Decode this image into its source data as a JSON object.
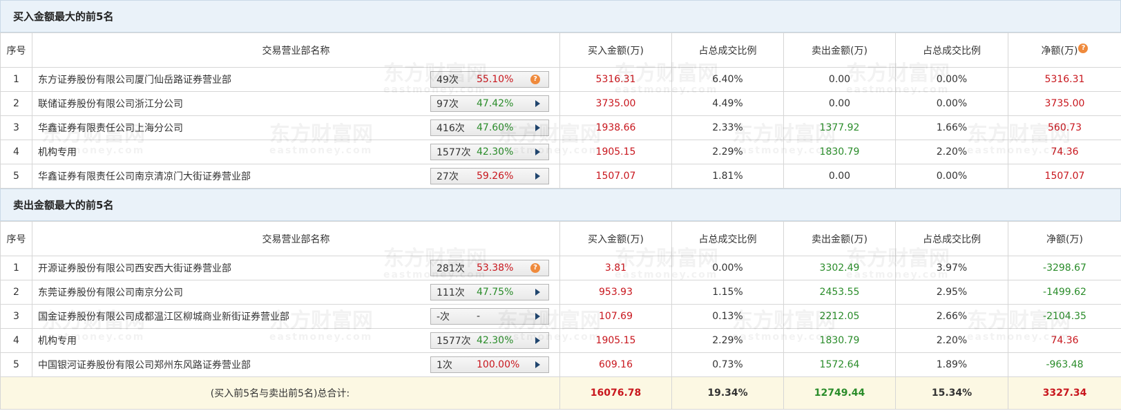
{
  "colors": {
    "red": "#c8161d",
    "green": "#2a8c2a",
    "header_bg": "#eaf2f9",
    "total_bg": "#fcf8e3"
  },
  "watermark": {
    "text": "东方财富网",
    "sub": "eastmoney.com"
  },
  "buy": {
    "title": "买入金额最大的前5名",
    "headers": {
      "idx": "序号",
      "name": "交易营业部名称",
      "buy": "买入金额(万)",
      "buy_ratio": "占总成交比例",
      "sell": "卖出金额(万)",
      "sell_ratio": "占总成交比例",
      "net": "净额(万)"
    },
    "rows": [
      {
        "idx": "1",
        "name": "东方证券股份有限公司厦门仙岳路证券营业部",
        "count": "49次",
        "pct": "55.10%",
        "pct_color": "red",
        "icon": "question-icon",
        "buy": "5316.31",
        "buy_ratio": "6.40%",
        "sell": "0.00",
        "sell_ratio": "0.00%",
        "net": "5316.31",
        "sell_color": "dark",
        "net_color": "red"
      },
      {
        "idx": "2",
        "name": "联储证券股份有限公司浙江分公司",
        "count": "97次",
        "pct": "47.42%",
        "pct_color": "green",
        "icon": "arrow-right-icon",
        "buy": "3735.00",
        "buy_ratio": "4.49%",
        "sell": "0.00",
        "sell_ratio": "0.00%",
        "net": "3735.00",
        "sell_color": "dark",
        "net_color": "red"
      },
      {
        "idx": "3",
        "name": "华鑫证券有限责任公司上海分公司",
        "count": "416次",
        "pct": "47.60%",
        "pct_color": "green",
        "icon": "arrow-right-icon",
        "buy": "1938.66",
        "buy_ratio": "2.33%",
        "sell": "1377.92",
        "sell_ratio": "1.66%",
        "net": "560.73",
        "sell_color": "green",
        "net_color": "red"
      },
      {
        "idx": "4",
        "name": "机构专用",
        "count": "1577次",
        "pct": "42.30%",
        "pct_color": "green",
        "icon": "arrow-right-icon",
        "buy": "1905.15",
        "buy_ratio": "2.29%",
        "sell": "1830.79",
        "sell_ratio": "2.20%",
        "net": "74.36",
        "sell_color": "green",
        "net_color": "red"
      },
      {
        "idx": "5",
        "name": "华鑫证券有限责任公司南京清凉门大街证券营业部",
        "count": "27次",
        "pct": "59.26%",
        "pct_color": "red",
        "icon": "arrow-right-icon",
        "buy": "1507.07",
        "buy_ratio": "1.81%",
        "sell": "0.00",
        "sell_ratio": "0.00%",
        "net": "1507.07",
        "sell_color": "dark",
        "net_color": "red"
      }
    ]
  },
  "sell": {
    "title": "卖出金额最大的前5名",
    "headers": {
      "idx": "序号",
      "name": "交易营业部名称",
      "buy": "买入金额(万)",
      "buy_ratio": "占总成交比例",
      "sell": "卖出金额(万)",
      "sell_ratio": "占总成交比例",
      "net": "净额(万)"
    },
    "rows": [
      {
        "idx": "1",
        "name": "开源证券股份有限公司西安西大街证券营业部",
        "count": "281次",
        "pct": "53.38%",
        "pct_color": "red",
        "icon": "question-icon",
        "buy": "3.81",
        "buy_ratio": "0.00%",
        "sell": "3302.49",
        "sell_ratio": "3.97%",
        "net": "-3298.67",
        "sell_color": "green",
        "net_color": "green"
      },
      {
        "idx": "2",
        "name": "东莞证券股份有限公司南京分公司",
        "count": "111次",
        "pct": "47.75%",
        "pct_color": "green",
        "icon": "arrow-right-icon",
        "buy": "953.93",
        "buy_ratio": "1.15%",
        "sell": "2453.55",
        "sell_ratio": "2.95%",
        "net": "-1499.62",
        "sell_color": "green",
        "net_color": "green"
      },
      {
        "idx": "3",
        "name": "国金证券股份有限公司成都温江区柳城商业新街证券营业部",
        "count": "-次",
        "pct": "-",
        "pct_color": "dark",
        "icon": "arrow-right-icon",
        "buy": "107.69",
        "buy_ratio": "0.13%",
        "sell": "2212.05",
        "sell_ratio": "2.66%",
        "net": "-2104.35",
        "sell_color": "green",
        "net_color": "green"
      },
      {
        "idx": "4",
        "name": "机构专用",
        "count": "1577次",
        "pct": "42.30%",
        "pct_color": "green",
        "icon": "arrow-right-icon",
        "buy": "1905.15",
        "buy_ratio": "2.29%",
        "sell": "1830.79",
        "sell_ratio": "2.20%",
        "net": "74.36",
        "sell_color": "green",
        "net_color": "red"
      },
      {
        "idx": "5",
        "name": "中国银河证券股份有限公司郑州东风路证券营业部",
        "count": "1次",
        "pct": "100.00%",
        "pct_color": "red",
        "icon": "arrow-right-icon",
        "buy": "609.16",
        "buy_ratio": "0.73%",
        "sell": "1572.64",
        "sell_ratio": "1.89%",
        "net": "-963.48",
        "sell_color": "green",
        "net_color": "green"
      }
    ]
  },
  "total": {
    "label": "(买入前5名与卖出前5名)总合计:",
    "buy": "16076.78",
    "buy_ratio": "19.34%",
    "sell": "12749.44",
    "sell_ratio": "15.34%",
    "net": "3327.34"
  }
}
